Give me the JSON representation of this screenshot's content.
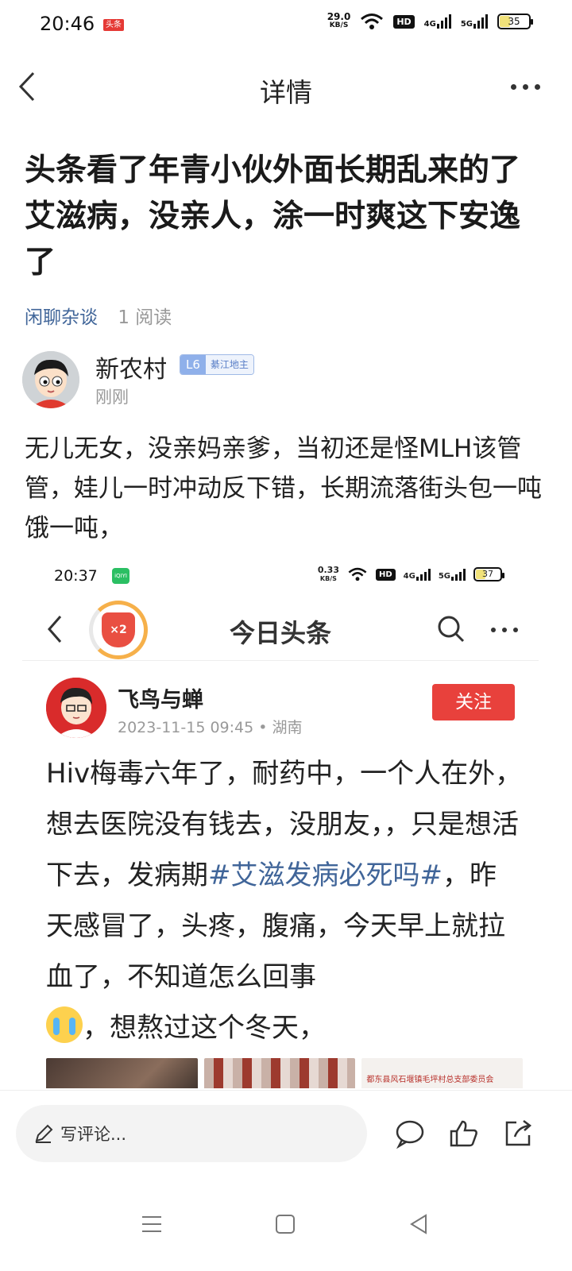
{
  "status_bar": {
    "time": "20:46",
    "app_badge": "头条",
    "speed_top": "29.0",
    "speed_unit": "KB/S",
    "hd": "HD",
    "net1": "4G",
    "net2": "5G",
    "battery": "35"
  },
  "nav": {
    "title": "详情"
  },
  "article": {
    "title": "头条看了年青小伙外面长期乱来的了艾滋病，没亲人，涂一时爽这下安逸了",
    "category": "闲聊杂谈",
    "reads": "1 阅读",
    "author": "新农村",
    "level": "L6",
    "level_title": "綦江地主",
    "time": "刚刚",
    "body": "无儿无女，没亲妈亲爹，当初还是怪MLH该管管，娃儿一时冲动反下错，长期流落街头包一吨饿一吨，"
  },
  "embedded": {
    "status_time": "20:37",
    "app_badge": "iQIYI",
    "speed_top": "0.33",
    "speed_unit": "KB/S",
    "hd": "HD",
    "net1": "4G",
    "net2": "5G",
    "battery": "37",
    "x2_label": "×2",
    "title": "今日头条",
    "author": "飞鸟与蝉",
    "date": "2023-11-15 09:45 • 湖南",
    "follow": "关注",
    "text_1": "Hiv梅毒六年了，耐药中，一个人在外，想去医院没有钱去，没朋友，，只是想活下去，发病期",
    "hashtag": "#艾滋发病必死吗#",
    "text_2": "，昨天感冒了，头疼，腹痛，今天早上就拉血了，不知道怎么回事",
    "text_3": "，想熬过这个冬天，",
    "thumb_caption": "都东县风石堰镇毛坪村总支部委员会"
  },
  "bottom": {
    "comment_placeholder": "写评论..."
  },
  "icons": {
    "back": "chevron-left-icon",
    "more": "more-dots-icon",
    "search": "search-icon",
    "comment": "comment-icon",
    "like": "thumbs-up-icon",
    "share": "share-icon",
    "menu": "menu-icon",
    "home": "home-icon",
    "sys_back": "triangle-back-icon"
  },
  "colors": {
    "link_blue": "#406599",
    "follow_red": "#e8413c",
    "level_blue": "#8fb0ea"
  }
}
